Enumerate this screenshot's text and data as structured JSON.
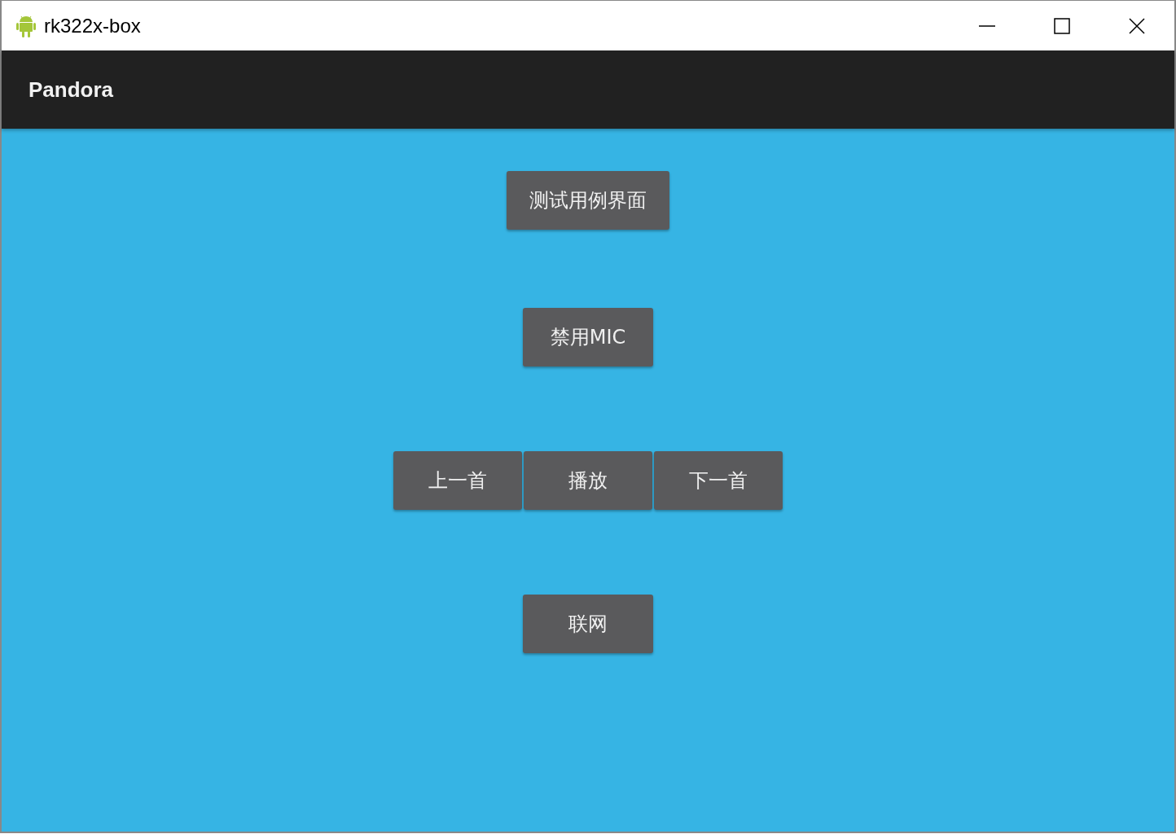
{
  "window": {
    "title": "rk322x-box"
  },
  "app_bar": {
    "title": "Pandora"
  },
  "rows": [
    {
      "buttons": [
        "测试用例界面"
      ]
    },
    {
      "buttons": [
        "禁用MIC"
      ]
    },
    {
      "buttons": [
        "上一首",
        "播放",
        "下一首"
      ]
    },
    {
      "buttons": [
        "联网"
      ]
    }
  ]
}
